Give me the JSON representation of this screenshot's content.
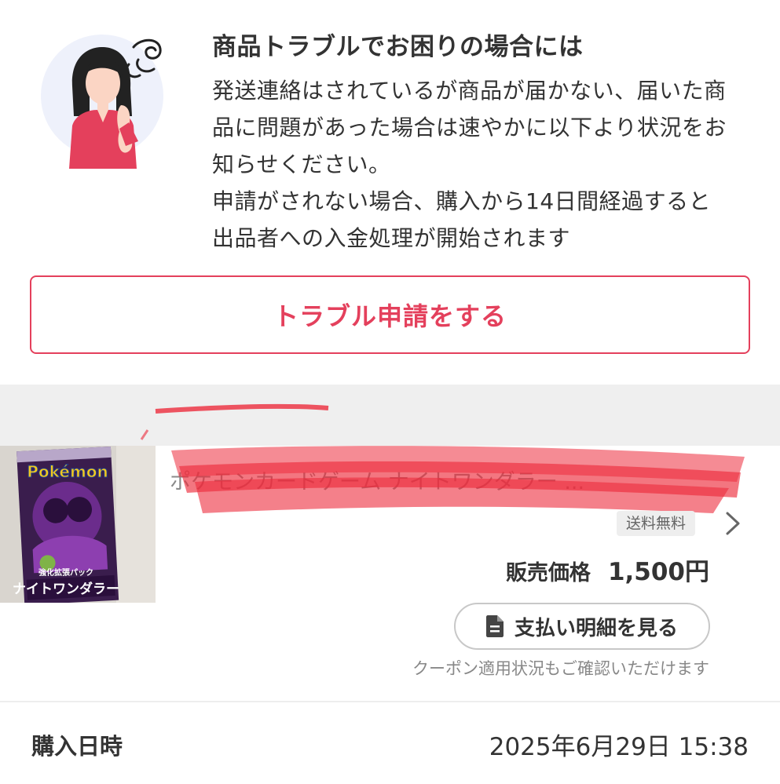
{
  "trouble": {
    "title": "商品トラブルでお困りの場合には",
    "lines": [
      "発送連絡はされているが商品が届かない、届いた商",
      "品に問題があった場合は速やかに以下より状況をお",
      "知らせください。",
      "申請がされない場合、購入から14日間経過すると",
      "出品者への入金処理が開始されます"
    ],
    "button_label": "トラブル申請をする"
  },
  "item": {
    "thumbnail_text": [
      "Pokémon",
      "強化拡張パック",
      "ナイトワンダラー"
    ],
    "name": "ポケモンカードゲーム ナイトワンダラー ...",
    "shipping_badge": "送料無料",
    "price_label": "販売価格",
    "price_value": "1,500円",
    "payment_button_label": "支払い明細を見る",
    "coupon_note": "クーポン適用状況もご確認いただけます"
  },
  "purchase": {
    "label": "購入日時",
    "value": "2025年6月29日 15:38"
  },
  "colors": {
    "accent": "#e4405c",
    "text": "#333333",
    "muted": "#888888",
    "band": "#efefef"
  }
}
